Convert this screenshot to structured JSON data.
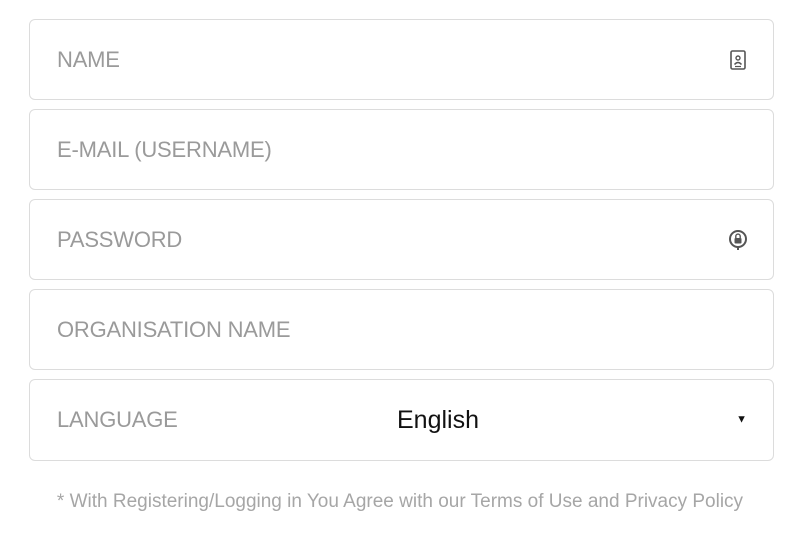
{
  "form": {
    "name": {
      "placeholder": "NAME",
      "value": "",
      "icon": "contact-card-icon"
    },
    "email": {
      "placeholder": "E-MAIL (USERNAME)",
      "value": ""
    },
    "password": {
      "placeholder": "PASSWORD",
      "value": "",
      "icon": "password-lock-icon"
    },
    "organisation": {
      "placeholder": "ORGANISATION NAME",
      "value": ""
    },
    "language": {
      "label": "LANGUAGE",
      "selected": "English"
    }
  },
  "legal": {
    "text_prefix": "* With Registering/Logging in You Agree with our ",
    "terms_link": "Terms of Use",
    "and": " and ",
    "privacy_link": "Privacy Policy"
  },
  "colors": {
    "border": "#dcdcdc",
    "placeholder": "#9a9a9a",
    "legal_text": "#a6a6a6"
  }
}
